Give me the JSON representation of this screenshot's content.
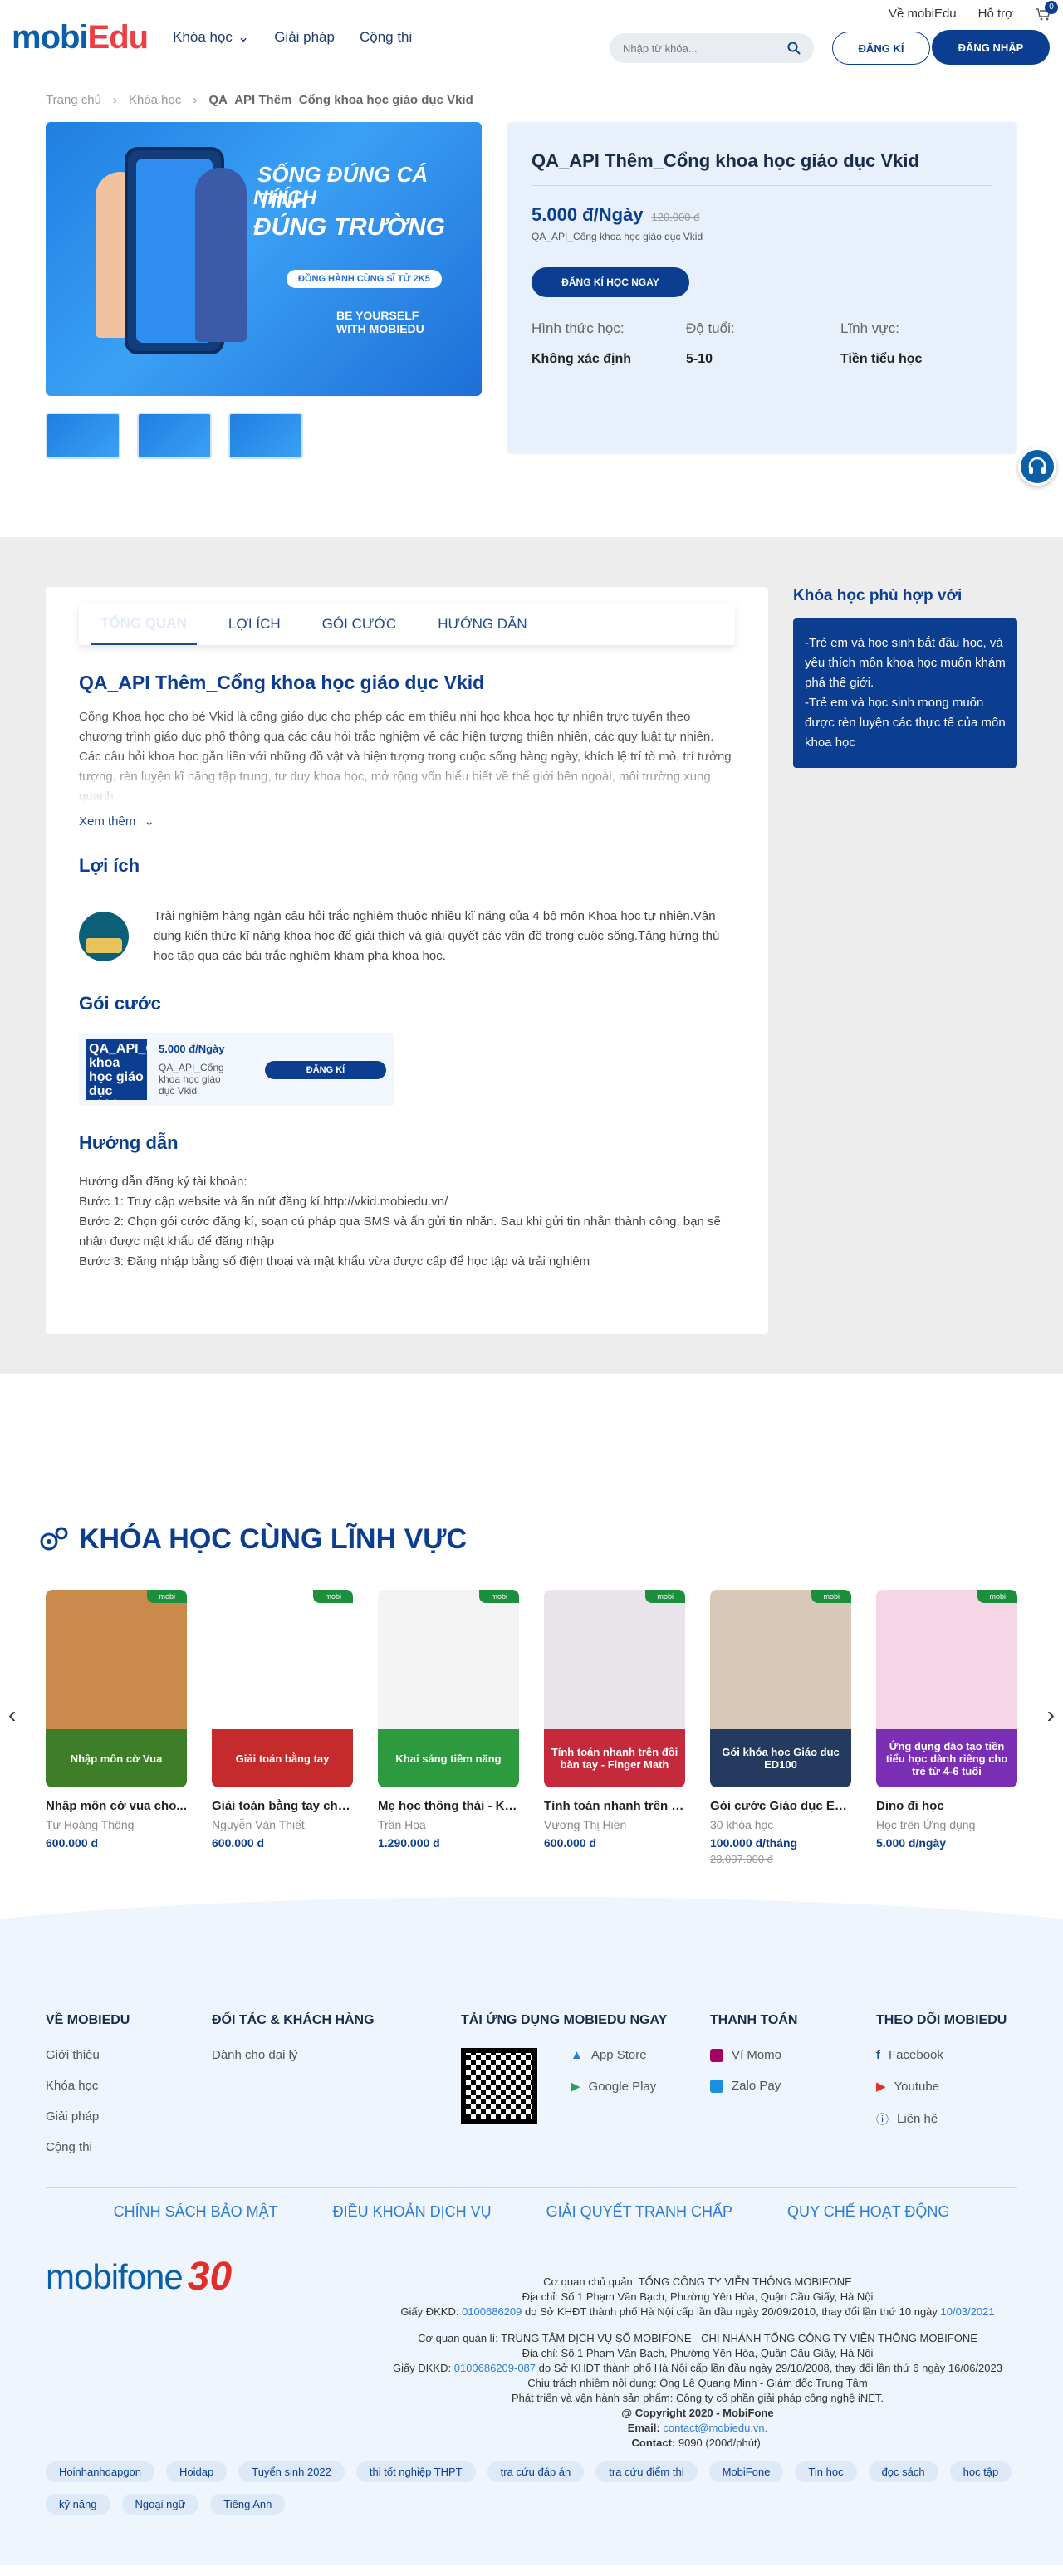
{
  "header": {
    "logo_mobi": "mobi",
    "logo_edu": "Edu",
    "nav": [
      "Khóa học",
      "Giải pháp",
      "Cộng thi"
    ],
    "top_links": [
      "Về mobiEdu",
      "Hỗ trợ"
    ],
    "cart_count": "0",
    "search_placeholder": "Nhập từ khóa...",
    "register_label": "ĐĂNG KÍ",
    "login_label": "ĐĂNG NHẬP"
  },
  "breadcrumb": [
    "Trang chủ",
    "Khóa học",
    "QA_API Thêm_Cổng khoa học giáo dục Vkid"
  ],
  "banner": {
    "line1": "SỐNG ĐÚNG CÁ TÍNH",
    "line2": "NHÍCH",
    "line3": "ĐÚNG TRƯỜNG",
    "pill": "ĐỒNG HÀNH CÙNG SĨ TỬ 2K5",
    "tag1": "BE YOURSELF",
    "tag2": "WITH MOBIEDU"
  },
  "product": {
    "title": "QA_API Thêm_Cổng khoa học giáo dục Vkid",
    "price": "5.000 đ/Ngày",
    "old_price": "120.000 đ",
    "package_name": "QA_API_Cổng khoa học giáo dục Vkid",
    "enroll_label": "ĐĂNG KÍ HỌC NGAY",
    "attrs": [
      {
        "k": "Hình thức học:",
        "v": "Không xác định"
      },
      {
        "k": "Độ tuổi:",
        "v": "5-10"
      },
      {
        "k": "Lĩnh vực:",
        "v": "Tiền tiểu học"
      }
    ]
  },
  "tabs": [
    "TỔNG QUAN",
    "LỢI ÍCH",
    "GÓI CƯỚC",
    "HƯỚNG DẪN"
  ],
  "overview": {
    "title": "QA_API Thêm_Cổng khoa học giáo dục Vkid",
    "text": "Cổng Khoa học cho bé Vkid là cổng giáo dục cho phép các em thiếu nhi học khoa học tự nhiên trực tuyến theo chương trình giáo dục phổ thông qua các câu hỏi trắc nghiệm về các hiện tượng thiên nhiên, các quy luật tự nhiên. Các câu hỏi khoa học gắn liền với những đồ vật và hiện tượng trong cuộc sống hàng ngày, khích lệ trí tò mò, trí tưởng tượng, rèn luyện kĩ năng tập trung, tư duy khoa học, mở rộng vốn hiểu biết về thế giới bên ngoài, môi trường xung quanh.",
    "see_more": "Xem thêm"
  },
  "benefits": {
    "title": "Lợi ích",
    "text": "Trải nghiệm hàng ngàn câu hỏi trắc nghiệm thuộc nhiều kĩ năng của 4 bộ môn Khoa học tự nhiên.Vận dụng kiến thức kĩ năng khoa học để giải thích và giải quyết các vấn đề trong cuộc sống.Tăng hứng thú học tập qua các bài trắc nghiệm khám phá khoa học."
  },
  "packages": {
    "title": "Gói cước",
    "img_text": "QA_API_Cổng khoa học giáo dục Vkid",
    "price": "5.000 đ/Ngày",
    "name": "QA_API_Cổng khoa học giáo dục Vkid",
    "button": "ĐĂNG KÍ"
  },
  "guide": {
    "title": "Hướng dẫn",
    "lines": [
      "Hướng dẫn đăng ký tài khoản:",
      "Bước 1: Truy cập website và ấn nút đăng kí.http://vkid.mobiedu.vn/",
      "Bước 2: Chọn gói cước đăng kí, soạn cú pháp qua SMS và ấn gửi tin nhắn. Sau khi gửi tin nhắn thành công, bạn sẽ nhận được mật khẩu để đăng nhập",
      "Bước 3: Đăng nhập bằng số điện thoại và mật khẩu vừa được cấp để học tập và trải nghiệm"
    ]
  },
  "sidebar": {
    "title": "Khóa học phù hợp với",
    "text1": "-Trẻ em và học sinh bắt đầu học, và yêu thích môn khoa học muốn khám phá thế giới.",
    "text2": "-Trẻ em và học sinh mong muốn được rèn luyện các thực tế của môn khoa học"
  },
  "related": {
    "title": "KHÓA HỌC CÙNG LĨNH VỰC",
    "courses": [
      {
        "img": "Nhập môn cờ Vua",
        "name": "Nhập môn cờ vua cho...",
        "author": "Từ Hoàng Thông",
        "price": "600.000 đ",
        "old": "",
        "bg": "#c98a4b",
        "cap": "#3f7e28"
      },
      {
        "img": "Giải toán bằng tay",
        "name": "Giải toán bằng tay cho tr...",
        "author": "Nguyễn Văn Thiết",
        "price": "600.000 đ",
        "old": "",
        "bg": "#ffffff",
        "cap": "#c52b2b"
      },
      {
        "img": "Khai sáng tiềm năng",
        "name": "Mẹ học thông thái - Khai...",
        "author": "Trần Hoa",
        "price": "1.290.000 đ",
        "old": "",
        "bg": "#f3f3f3",
        "cap": "#2e9a3f"
      },
      {
        "img": "Tính toán nhanh trên đôi bàn tay - Finger Math",
        "name": "Tính toán nhanh trên đôi...",
        "author": "Vương Thị Hiền",
        "price": "600.000 đ",
        "old": "",
        "bg": "#e9e4ea",
        "cap": "#c42a3c"
      },
      {
        "img": "Gói khóa học Giáo dục ED100",
        "name": "Gói cước Giáo dục ED100",
        "author": "30 khóa học",
        "price": "100.000 đ/tháng",
        "old": "23.007.000 đ",
        "bg": "#d8c8b8",
        "cap": "#243a5e"
      },
      {
        "img": "Ứng dụng đào tạo tiền tiểu học dành riêng cho trẻ từ 4-6 tuổi",
        "name": "Dino đi học",
        "author": "Học trên Ứng dụng",
        "price": "5.000 đ/ngày",
        "old": "",
        "bg": "#f6d6e6",
        "cap": "#7b2fb5"
      }
    ]
  },
  "footer": {
    "cols": [
      {
        "title": "VỀ MOBIEDU",
        "items": [
          "Giới thiệu",
          "Khóa học",
          "Giải pháp",
          "Cộng thi"
        ]
      },
      {
        "title": "ĐỐI TÁC & KHÁCH HÀNG",
        "items": [
          "Dành cho đại lý"
        ]
      },
      {
        "title": "TẢI ỨNG DỤNG MOBIEDU NGAY",
        "items": [
          "App Store",
          "Google Play"
        ]
      },
      {
        "title": "THANH TOÁN",
        "items": [
          "Ví Momo",
          "Zalo Pay"
        ]
      },
      {
        "title": "THEO DÕI MOBIEDU",
        "items": [
          "Facebook",
          "Youtube",
          "Liên hệ"
        ]
      }
    ],
    "policies": [
      "CHÍNH SÁCH BẢO MẬT",
      "ĐIỀU KHOẢN DỊCH VỤ",
      "GIẢI QUYẾT TRANH CHẤP",
      "QUY CHẾ HOẠT ĐỘNG"
    ],
    "mobifone": "mobifone",
    "mobifone_30": "30",
    "legal": {
      "l1": "Cơ quan chủ quản: TỔNG CÔNG TY VIỄN THÔNG MOBIFONE",
      "l2": "Địa chỉ: Số 1 Phạm Văn Bạch, Phường Yên Hòa, Quận Cầu Giấy, Hà Nội",
      "l3a": "Giấy ĐKKD: ",
      "l3b": "0100686209",
      "l3c": " do Sở KHĐT thành phố Hà Nội cấp lần đầu ngày 20/09/2010, thay đổi lần thứ 10 ngày ",
      "l3d": "10/03/2021",
      "l4": "Cơ quan quản lí: TRUNG TÂM DỊCH VỤ SỐ MOBIFONE - CHI NHÁNH TỔNG CÔNG TY VIỄN THÔNG MOBIFONE",
      "l5": "Địa chỉ: Số 1 Phạm Văn Bạch, Phường Yên Hòa, Quận Cầu Giấy, Hà Nội",
      "l6a": "Giấy ĐKKD: ",
      "l6b": "0100686209-087",
      "l6c": " do Sở KHĐT thành phố Hà Nội cấp lần đầu ngày 29/10/2008, thay đổi lần thứ 6 ngày 16/06/2023",
      "l7": "Chịu trách nhiệm nội dung: Ông Lê Quang Minh - Giám đốc Trung Tâm",
      "l8": "Phát triển và vận hành sản phẩm: Công ty cổ phần giải pháp công nghệ iNET.",
      "l9": "@ Copyright 2020 - MobiFone",
      "l10a": "Email: ",
      "l10b": "contact@mobiedu.vn.",
      "l11a": "Contact: ",
      "l11b": "9090 (200đ/phút)."
    },
    "tags": [
      "Hoinhanhdapgon",
      "Hoidap",
      "Tuyển sinh 2022",
      "thi tốt nghiệp THPT",
      "tra cứu đáp án",
      "tra cứu điểm thi",
      "MobiFone",
      "Tin học",
      "đọc sách",
      "học tập",
      "kỹ năng",
      "Ngoại ngữ",
      "Tiếng Anh"
    ]
  }
}
